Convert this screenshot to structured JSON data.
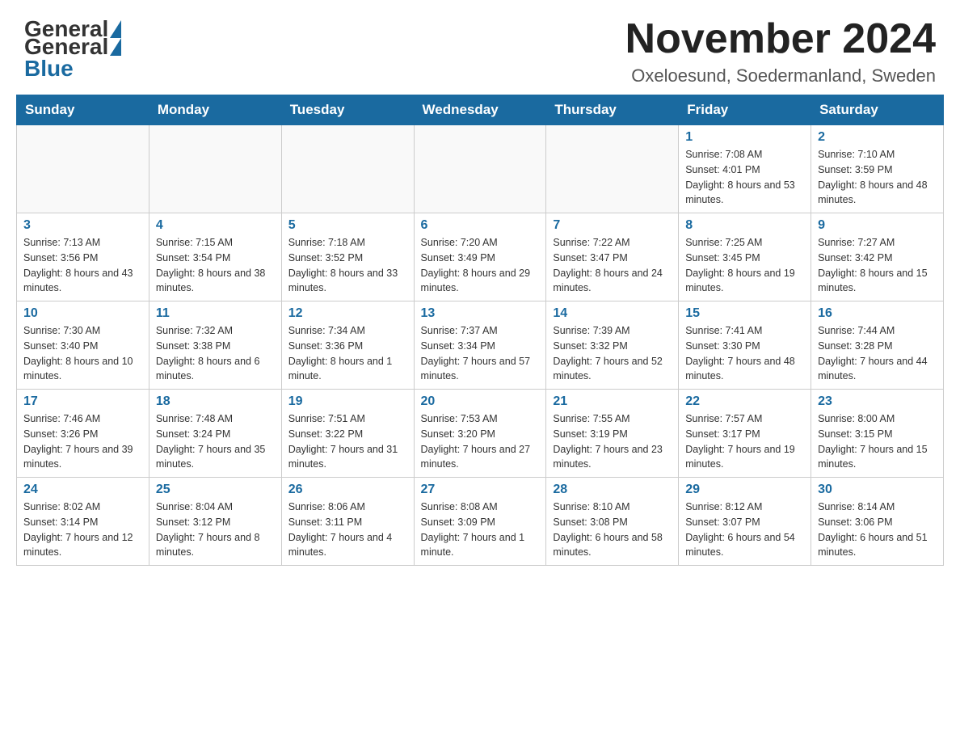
{
  "header": {
    "logo_general": "General",
    "logo_blue": "Blue",
    "month_title": "November 2024",
    "location": "Oxeloesund, Soedermanland, Sweden"
  },
  "days_of_week": [
    "Sunday",
    "Monday",
    "Tuesday",
    "Wednesday",
    "Thursday",
    "Friday",
    "Saturday"
  ],
  "weeks": [
    [
      {
        "day": "",
        "sunrise": "",
        "sunset": "",
        "daylight": "",
        "empty": true
      },
      {
        "day": "",
        "sunrise": "",
        "sunset": "",
        "daylight": "",
        "empty": true
      },
      {
        "day": "",
        "sunrise": "",
        "sunset": "",
        "daylight": "",
        "empty": true
      },
      {
        "day": "",
        "sunrise": "",
        "sunset": "",
        "daylight": "",
        "empty": true
      },
      {
        "day": "",
        "sunrise": "",
        "sunset": "",
        "daylight": "",
        "empty": true
      },
      {
        "day": "1",
        "sunrise": "Sunrise: 7:08 AM",
        "sunset": "Sunset: 4:01 PM",
        "daylight": "Daylight: 8 hours and 53 minutes.",
        "empty": false
      },
      {
        "day": "2",
        "sunrise": "Sunrise: 7:10 AM",
        "sunset": "Sunset: 3:59 PM",
        "daylight": "Daylight: 8 hours and 48 minutes.",
        "empty": false
      }
    ],
    [
      {
        "day": "3",
        "sunrise": "Sunrise: 7:13 AM",
        "sunset": "Sunset: 3:56 PM",
        "daylight": "Daylight: 8 hours and 43 minutes.",
        "empty": false
      },
      {
        "day": "4",
        "sunrise": "Sunrise: 7:15 AM",
        "sunset": "Sunset: 3:54 PM",
        "daylight": "Daylight: 8 hours and 38 minutes.",
        "empty": false
      },
      {
        "day": "5",
        "sunrise": "Sunrise: 7:18 AM",
        "sunset": "Sunset: 3:52 PM",
        "daylight": "Daylight: 8 hours and 33 minutes.",
        "empty": false
      },
      {
        "day": "6",
        "sunrise": "Sunrise: 7:20 AM",
        "sunset": "Sunset: 3:49 PM",
        "daylight": "Daylight: 8 hours and 29 minutes.",
        "empty": false
      },
      {
        "day": "7",
        "sunrise": "Sunrise: 7:22 AM",
        "sunset": "Sunset: 3:47 PM",
        "daylight": "Daylight: 8 hours and 24 minutes.",
        "empty": false
      },
      {
        "day": "8",
        "sunrise": "Sunrise: 7:25 AM",
        "sunset": "Sunset: 3:45 PM",
        "daylight": "Daylight: 8 hours and 19 minutes.",
        "empty": false
      },
      {
        "day": "9",
        "sunrise": "Sunrise: 7:27 AM",
        "sunset": "Sunset: 3:42 PM",
        "daylight": "Daylight: 8 hours and 15 minutes.",
        "empty": false
      }
    ],
    [
      {
        "day": "10",
        "sunrise": "Sunrise: 7:30 AM",
        "sunset": "Sunset: 3:40 PM",
        "daylight": "Daylight: 8 hours and 10 minutes.",
        "empty": false
      },
      {
        "day": "11",
        "sunrise": "Sunrise: 7:32 AM",
        "sunset": "Sunset: 3:38 PM",
        "daylight": "Daylight: 8 hours and 6 minutes.",
        "empty": false
      },
      {
        "day": "12",
        "sunrise": "Sunrise: 7:34 AM",
        "sunset": "Sunset: 3:36 PM",
        "daylight": "Daylight: 8 hours and 1 minute.",
        "empty": false
      },
      {
        "day": "13",
        "sunrise": "Sunrise: 7:37 AM",
        "sunset": "Sunset: 3:34 PM",
        "daylight": "Daylight: 7 hours and 57 minutes.",
        "empty": false
      },
      {
        "day": "14",
        "sunrise": "Sunrise: 7:39 AM",
        "sunset": "Sunset: 3:32 PM",
        "daylight": "Daylight: 7 hours and 52 minutes.",
        "empty": false
      },
      {
        "day": "15",
        "sunrise": "Sunrise: 7:41 AM",
        "sunset": "Sunset: 3:30 PM",
        "daylight": "Daylight: 7 hours and 48 minutes.",
        "empty": false
      },
      {
        "day": "16",
        "sunrise": "Sunrise: 7:44 AM",
        "sunset": "Sunset: 3:28 PM",
        "daylight": "Daylight: 7 hours and 44 minutes.",
        "empty": false
      }
    ],
    [
      {
        "day": "17",
        "sunrise": "Sunrise: 7:46 AM",
        "sunset": "Sunset: 3:26 PM",
        "daylight": "Daylight: 7 hours and 39 minutes.",
        "empty": false
      },
      {
        "day": "18",
        "sunrise": "Sunrise: 7:48 AM",
        "sunset": "Sunset: 3:24 PM",
        "daylight": "Daylight: 7 hours and 35 minutes.",
        "empty": false
      },
      {
        "day": "19",
        "sunrise": "Sunrise: 7:51 AM",
        "sunset": "Sunset: 3:22 PM",
        "daylight": "Daylight: 7 hours and 31 minutes.",
        "empty": false
      },
      {
        "day": "20",
        "sunrise": "Sunrise: 7:53 AM",
        "sunset": "Sunset: 3:20 PM",
        "daylight": "Daylight: 7 hours and 27 minutes.",
        "empty": false
      },
      {
        "day": "21",
        "sunrise": "Sunrise: 7:55 AM",
        "sunset": "Sunset: 3:19 PM",
        "daylight": "Daylight: 7 hours and 23 minutes.",
        "empty": false
      },
      {
        "day": "22",
        "sunrise": "Sunrise: 7:57 AM",
        "sunset": "Sunset: 3:17 PM",
        "daylight": "Daylight: 7 hours and 19 minutes.",
        "empty": false
      },
      {
        "day": "23",
        "sunrise": "Sunrise: 8:00 AM",
        "sunset": "Sunset: 3:15 PM",
        "daylight": "Daylight: 7 hours and 15 minutes.",
        "empty": false
      }
    ],
    [
      {
        "day": "24",
        "sunrise": "Sunrise: 8:02 AM",
        "sunset": "Sunset: 3:14 PM",
        "daylight": "Daylight: 7 hours and 12 minutes.",
        "empty": false
      },
      {
        "day": "25",
        "sunrise": "Sunrise: 8:04 AM",
        "sunset": "Sunset: 3:12 PM",
        "daylight": "Daylight: 7 hours and 8 minutes.",
        "empty": false
      },
      {
        "day": "26",
        "sunrise": "Sunrise: 8:06 AM",
        "sunset": "Sunset: 3:11 PM",
        "daylight": "Daylight: 7 hours and 4 minutes.",
        "empty": false
      },
      {
        "day": "27",
        "sunrise": "Sunrise: 8:08 AM",
        "sunset": "Sunset: 3:09 PM",
        "daylight": "Daylight: 7 hours and 1 minute.",
        "empty": false
      },
      {
        "day": "28",
        "sunrise": "Sunrise: 8:10 AM",
        "sunset": "Sunset: 3:08 PM",
        "daylight": "Daylight: 6 hours and 58 minutes.",
        "empty": false
      },
      {
        "day": "29",
        "sunrise": "Sunrise: 8:12 AM",
        "sunset": "Sunset: 3:07 PM",
        "daylight": "Daylight: 6 hours and 54 minutes.",
        "empty": false
      },
      {
        "day": "30",
        "sunrise": "Sunrise: 8:14 AM",
        "sunset": "Sunset: 3:06 PM",
        "daylight": "Daylight: 6 hours and 51 minutes.",
        "empty": false
      }
    ]
  ]
}
